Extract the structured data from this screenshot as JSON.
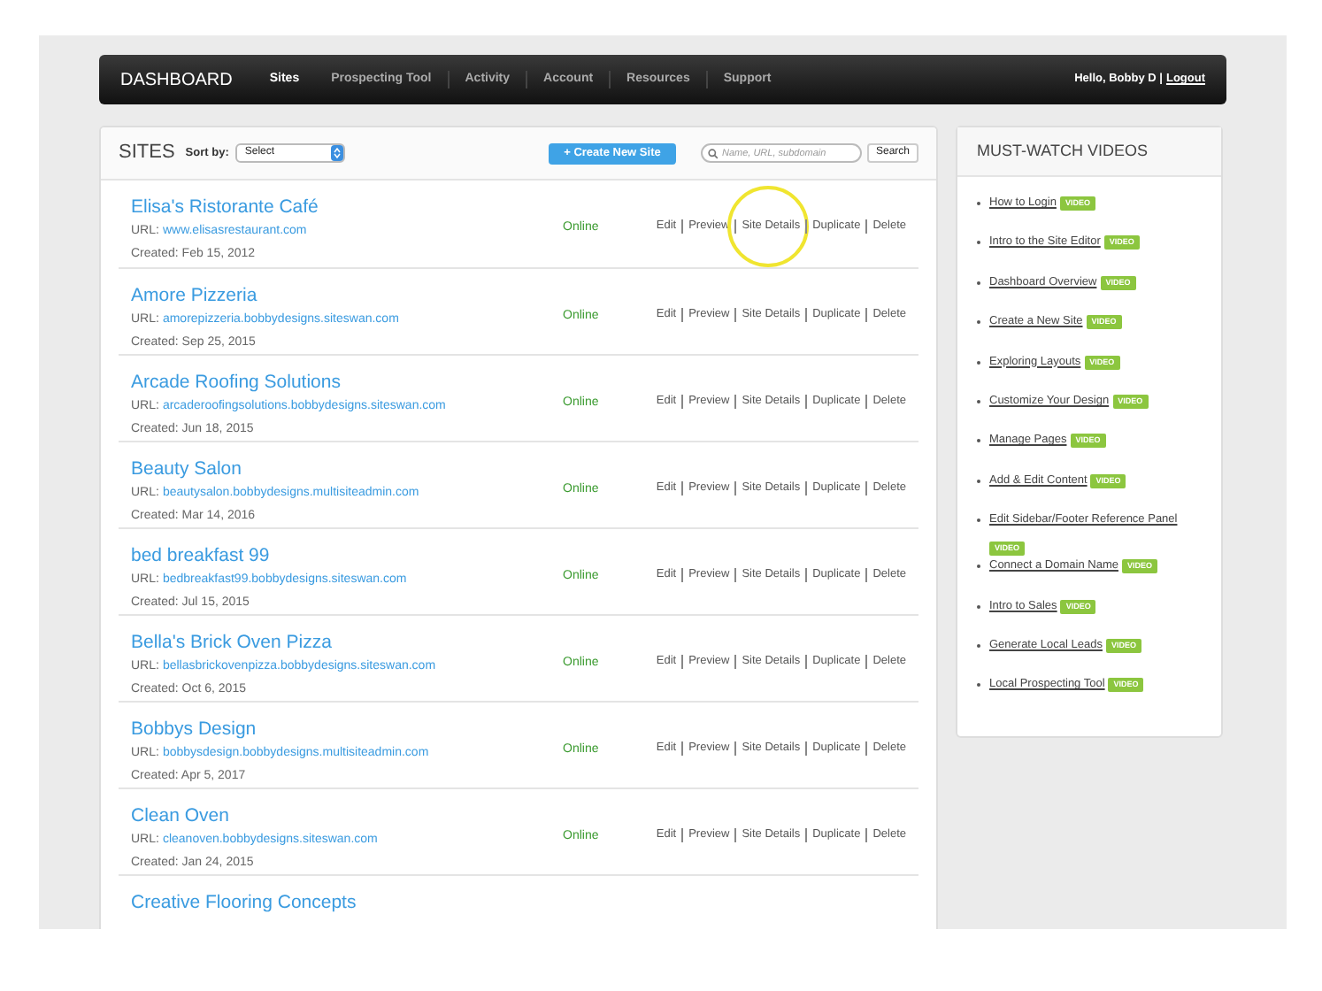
{
  "nav": {
    "brand": "DASHBOARD",
    "items": [
      {
        "label": "Sites",
        "selected": true
      },
      {
        "label": "Prospecting Tool",
        "selected": false
      },
      {
        "label": "Activity",
        "selected": false
      },
      {
        "label": "Account",
        "selected": false
      },
      {
        "label": "Resources",
        "selected": false
      },
      {
        "label": "Support",
        "selected": false
      }
    ],
    "greeting": "Hello, Bobby D |",
    "logout": "Logout"
  },
  "sites_panel": {
    "title": "SITES",
    "sort_label": "Sort by:",
    "sort_value": "Select",
    "create_button": "+ Create New Site",
    "search_placeholder": "Name, URL, subdomain",
    "search_button": "Search",
    "rows": [
      {
        "name": "Elisa's Ristorante Café",
        "url_label": "URL:",
        "url": "www.elisasrestaurant.com",
        "created": "Created: Feb 15, 2012",
        "status": "Online",
        "actions": [
          {
            "label": "Edit",
            "circled": false
          },
          {
            "label": "Preview",
            "circled": false
          },
          {
            "label": "Site Details",
            "circled": true
          },
          {
            "label": "Duplicate",
            "circled": false
          },
          {
            "label": "Delete",
            "circled": false
          }
        ]
      },
      {
        "name": "Amore Pizzeria",
        "url_label": "URL:",
        "url": "amorepizzeria.bobbydesigns.siteswan.com",
        "created": "Created: Sep 25, 2015",
        "status": "Online",
        "actions": [
          "Edit",
          "Preview",
          "Site Details",
          "Duplicate",
          "Delete"
        ]
      },
      {
        "name": "Arcade Roofing Solutions",
        "url_label": "URL:",
        "url": "arcaderoofingsolutions.bobbydesigns.siteswan.com",
        "created": "Created: Jun 18, 2015",
        "status": "Online",
        "actions": [
          "Edit",
          "Preview",
          "Site Details",
          "Duplicate",
          "Delete"
        ]
      },
      {
        "name": "Beauty Salon",
        "url_label": "URL:",
        "url": "beautysalon.bobbydesigns.multisiteadmin.com",
        "created": "Created: Mar 14, 2016",
        "status": "Online",
        "actions": [
          "Edit",
          "Preview",
          "Site Details",
          "Duplicate",
          "Delete"
        ]
      },
      {
        "name": "bed breakfast 99",
        "url_label": "URL:",
        "url": "bedbreakfast99.bobbydesigns.siteswan.com",
        "created": "Created: Jul 15, 2015",
        "status": "Online",
        "actions": [
          "Edit",
          "Preview",
          "Site Details",
          "Duplicate",
          "Delete"
        ]
      },
      {
        "name": "Bella's Brick Oven Pizza",
        "url_label": "URL:",
        "url": "bellasbrickovenpizza.bobbydesigns.siteswan.com",
        "created": "Created: Oct 6, 2015",
        "status": "Online",
        "actions": [
          "Edit",
          "Preview",
          "Site Details",
          "Duplicate",
          "Delete"
        ]
      },
      {
        "name": "Bobbys Design",
        "url_label": "URL:",
        "url": "bobbysdesign.bobbydesigns.multisiteadmin.com",
        "created": "Created: Apr 5, 2017",
        "status": "Online",
        "actions": [
          "Edit",
          "Preview",
          "Site Details",
          "Duplicate",
          "Delete"
        ]
      },
      {
        "name": "Clean Oven",
        "url_label": "URL:",
        "url": "cleanoven.bobbydesigns.siteswan.com",
        "created": "Created: Jan 24, 2015",
        "status": "Online",
        "actions": [
          "Edit",
          "Preview",
          "Site Details",
          "Duplicate",
          "Delete"
        ]
      },
      {
        "name": "Creative Flooring Concepts"
      }
    ]
  },
  "videos_panel": {
    "title": "MUST-WATCH VIDEOS",
    "items": [
      {
        "label": "How to Login",
        "badge": "VIDEO"
      },
      {
        "label": "Intro to the Site Editor",
        "badge": "VIDEO"
      },
      {
        "label": "Dashboard Overview",
        "badge": "VIDEO"
      },
      {
        "label": "Create a New Site",
        "badge": "VIDEO"
      },
      {
        "label": "Exploring Layouts",
        "badge": "VIDEO"
      },
      {
        "label": "Customize Your Design",
        "badge": "VIDEO"
      },
      {
        "label": "Manage Pages",
        "badge": "VIDEO"
      },
      {
        "label": "Add & Edit Content",
        "badge": "VIDEO"
      },
      {
        "label": "Edit Sidebar/Footer Reference Panel",
        "badge": "VIDEO"
      },
      {
        "label": "Connect a Domain Name",
        "badge": "VIDEO"
      },
      {
        "label": "Intro to Sales",
        "badge": "VIDEO"
      },
      {
        "label": "Generate Local Leads",
        "badge": "VIDEO"
      },
      {
        "label": "Local Prospecting Tool",
        "badge": "VIDEO"
      }
    ]
  }
}
